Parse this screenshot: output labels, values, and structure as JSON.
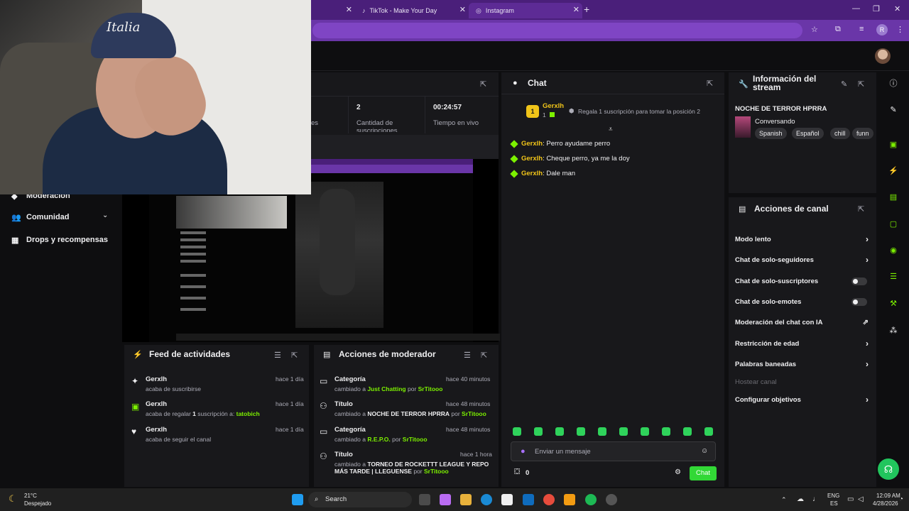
{
  "browser": {
    "tabs": [
      {
        "label": ""
      },
      {
        "label": "TikTok - Make Your Day"
      },
      {
        "label": "Instagram"
      }
    ],
    "profile_initial": "R"
  },
  "stats": {
    "items": [
      {
        "value": "",
        "label": "es"
      },
      {
        "value": "2",
        "label": "Cantidad de suscripciones"
      },
      {
        "value": "00:24:57",
        "label": "Tiempo en vivo"
      }
    ]
  },
  "leftnav": {
    "items": [
      {
        "label": "Moderación"
      },
      {
        "label": "Comunidad"
      },
      {
        "label": "Drops y recompensas"
      }
    ]
  },
  "feed": {
    "title": "Feed de actividades",
    "rows": [
      {
        "name": "Gerxlh",
        "time": "hace 1 día",
        "text": "acaba de suscribirse",
        "target": ""
      },
      {
        "name": "Gerxlh",
        "time": "hace 1 día",
        "text_pre": "acaba de regalar ",
        "count": "1",
        "text_post": " suscripción a: ",
        "target": "tatobich"
      },
      {
        "name": "Gerxlh",
        "time": "hace 1 día",
        "text": "acaba de seguir el canal",
        "target": ""
      }
    ]
  },
  "mod_actions": {
    "title": "Acciones de moderador",
    "rows": [
      {
        "type": "Categoría",
        "time": "hace 40 minutos",
        "pre": "cambiado a ",
        "value": "Just Chatting",
        "by": " por ",
        "user": "SrTitooo"
      },
      {
        "type": "Título",
        "time": "hace 48 minutos",
        "pre": "cambiado a ",
        "value": "NOCHE DE TERROR HPRRA",
        "by": " por ",
        "user": "SrTitooo"
      },
      {
        "type": "Categoría",
        "time": "hace 48 minutos",
        "pre": "cambiado a ",
        "value": "R.E.P.O.",
        "by": " por ",
        "user": "SrTitooo"
      },
      {
        "type": "Título",
        "time": "hace 1 hora",
        "pre": "cambiado a ",
        "value": "TORNEO DE ROCKETTT LEAGUE Y REPO MÁS TARDE | LLEGUENSE",
        "by": " por ",
        "user": "SrTitooo"
      }
    ]
  },
  "chat": {
    "title": "Chat",
    "leader": {
      "rank": "1",
      "name": "Gerxlh",
      "count": "1"
    },
    "gift_prompt": "Regala 1 suscripción para tomar la posición 2",
    "messages": [
      {
        "user": "Gerxlh",
        "text": ": Perro ayudame perro"
      },
      {
        "user": "Gerxlh",
        "text": ": Cheque perro, ya me la doy"
      },
      {
        "user": "Gerxlh",
        "text": ": Dale man"
      }
    ],
    "input_placeholder": "Enviar un mensaje",
    "points": "0",
    "send_label": "Chat"
  },
  "stream_info": {
    "title": "Información del stream",
    "stream_title": "NOCHE DE TERROR HPRRA",
    "category": "Conversando",
    "tags": [
      "Spanish",
      "Español",
      "chill",
      "funn"
    ]
  },
  "channel_actions": {
    "title": "Acciones de canal",
    "items": [
      {
        "label": "Modo lento",
        "control": "chevron"
      },
      {
        "label": "Chat de solo-seguidores",
        "control": "chevron"
      },
      {
        "label": "Chat de solo-suscriptores",
        "control": "toggle"
      },
      {
        "label": "Chat de solo-emotes",
        "control": "toggle"
      },
      {
        "label": "Moderación del chat con IA",
        "control": "external"
      },
      {
        "label": "Restricción de edad",
        "control": "chevron"
      },
      {
        "label": "Palabras baneadas",
        "control": "chevron"
      },
      {
        "label": "Hostear canal",
        "control": "disabled"
      },
      {
        "label": "Configurar objetivos",
        "control": "chevron"
      }
    ]
  },
  "taskbar": {
    "weather_temp": "21°C",
    "weather_desc": "Despejado",
    "search_label": "Search",
    "lang_top": "ENG",
    "lang_bottom": "ES",
    "time": "12:09 AM",
    "date": "4/28/2026"
  },
  "webcam": {
    "cap_text": "Italia"
  },
  "colors": {
    "accent": "#7cf000",
    "chat_button": "#32d836",
    "browser_purple": "#4a1f7a"
  }
}
